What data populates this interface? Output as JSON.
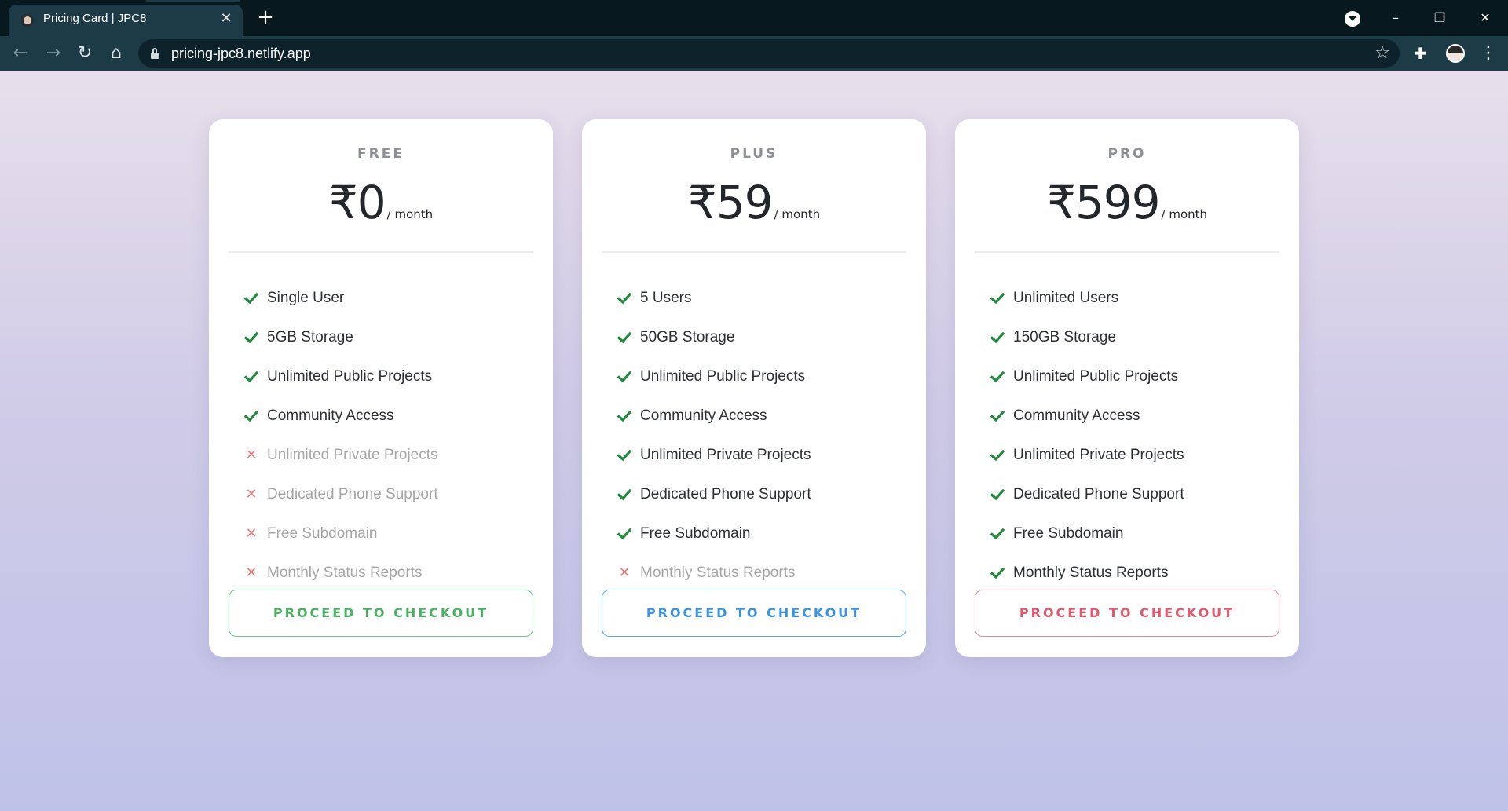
{
  "browser": {
    "tab_title": "Pricing Card | JPC8",
    "tab_close_icon": "close-icon",
    "new_tab_icon": "plus-icon",
    "url": "pricing-jpc8.netlify.app",
    "back_icon": "arrow-left-icon",
    "forward_icon": "arrow-right-icon",
    "reload_icon": "reload-icon",
    "home_icon": "home-icon",
    "bookmark_icon": "star-icon",
    "extensions_icon": "puzzle-icon",
    "menu_icon": "kebab-menu-icon"
  },
  "colors": {
    "page_gradient_top": "#e7dfeb",
    "page_gradient_bottom": "#bfc2e8",
    "check": "#1f8a3b",
    "cross": "#ee7a7a",
    "green": "#4caf64",
    "blue": "#3d92e0",
    "red": "#e05a6e"
  },
  "plans": [
    {
      "name": "FREE",
      "price": "₹0",
      "per": "/ month",
      "button": "PROCEED TO CHECKOUT",
      "button_color": "green",
      "features": [
        {
          "label": "Single User",
          "included": true
        },
        {
          "label": "5GB Storage",
          "included": true
        },
        {
          "label": "Unlimited Public Projects",
          "included": true
        },
        {
          "label": "Community Access",
          "included": true
        },
        {
          "label": "Unlimited Private Projects",
          "included": false
        },
        {
          "label": "Dedicated Phone Support",
          "included": false
        },
        {
          "label": "Free Subdomain",
          "included": false
        },
        {
          "label": "Monthly Status Reports",
          "included": false
        }
      ]
    },
    {
      "name": "PLUS",
      "price": "₹59",
      "per": "/ month",
      "button": "PROCEED TO CHECKOUT",
      "button_color": "blue",
      "features": [
        {
          "label": "5 Users",
          "included": true
        },
        {
          "label": "50GB Storage",
          "included": true
        },
        {
          "label": "Unlimited Public Projects",
          "included": true
        },
        {
          "label": "Community Access",
          "included": true
        },
        {
          "label": "Unlimited Private Projects",
          "included": true
        },
        {
          "label": "Dedicated Phone Support",
          "included": true
        },
        {
          "label": "Free Subdomain",
          "included": true
        },
        {
          "label": "Monthly Status Reports",
          "included": false
        }
      ]
    },
    {
      "name": "PRO",
      "price": "₹599",
      "per": "/ month",
      "button": "PROCEED TO CHECKOUT",
      "button_color": "red",
      "features": [
        {
          "label": "Unlimited Users",
          "included": true
        },
        {
          "label": "150GB Storage",
          "included": true
        },
        {
          "label": "Unlimited Public Projects",
          "included": true
        },
        {
          "label": "Community Access",
          "included": true
        },
        {
          "label": "Unlimited Private Projects",
          "included": true
        },
        {
          "label": "Dedicated Phone Support",
          "included": true
        },
        {
          "label": "Free Subdomain",
          "included": true
        },
        {
          "label": "Monthly Status Reports",
          "included": true
        }
      ]
    }
  ]
}
